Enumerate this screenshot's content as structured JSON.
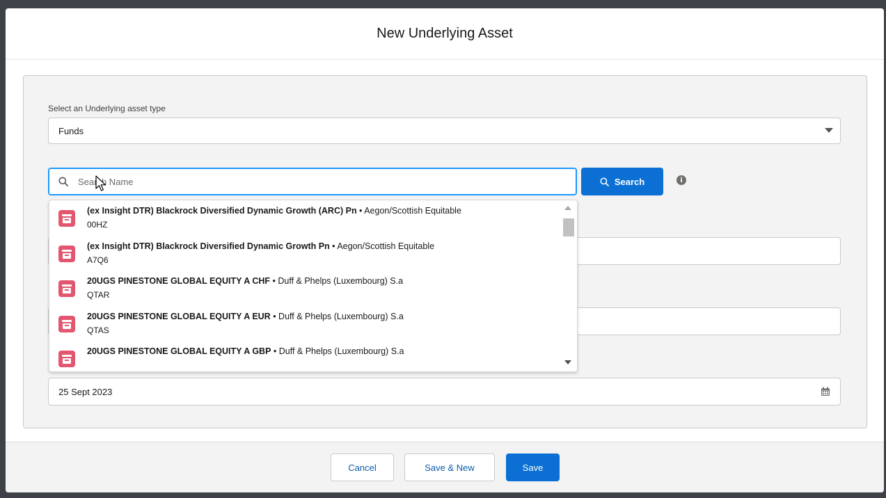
{
  "modal": {
    "title": "New Underlying Asset"
  },
  "asset_type": {
    "label": "Select an Underlying asset type",
    "value": "Funds"
  },
  "search": {
    "placeholder": "Search Name",
    "button_label": "Search",
    "info_icon": "info-icon"
  },
  "results": [
    {
      "name": "(ex Insight DTR) Blackrock Diversified Dynamic Growth (ARC) Pn",
      "provider": "Aegon/Scottish Equitable",
      "code": "00HZ"
    },
    {
      "name": "(ex Insight DTR) Blackrock Diversified Dynamic Growth Pn",
      "provider": "Aegon/Scottish Equitable",
      "code": "A7Q6"
    },
    {
      "name": "20UGS PINESTONE GLOBAL EQUITY A CHF",
      "provider": "Duff & Phelps (Luxembourg) S.a",
      "code": "QTAR"
    },
    {
      "name": "20UGS PINESTONE GLOBAL EQUITY A EUR",
      "provider": "Duff & Phelps (Luxembourg) S.a",
      "code": "QTAS"
    },
    {
      "name": "20UGS PINESTONE GLOBAL EQUITY A GBP",
      "provider": "Duff & Phelps (Luxembourg) S.a",
      "code": ""
    }
  ],
  "date_field": {
    "value": "25 Sept 2023"
  },
  "footer": {
    "cancel_label": "Cancel",
    "save_new_label": "Save & New",
    "save_label": "Save"
  },
  "colors": {
    "brand": "#0b6fd3",
    "focus": "#1b96ff",
    "result_icon": "#e3566f"
  }
}
